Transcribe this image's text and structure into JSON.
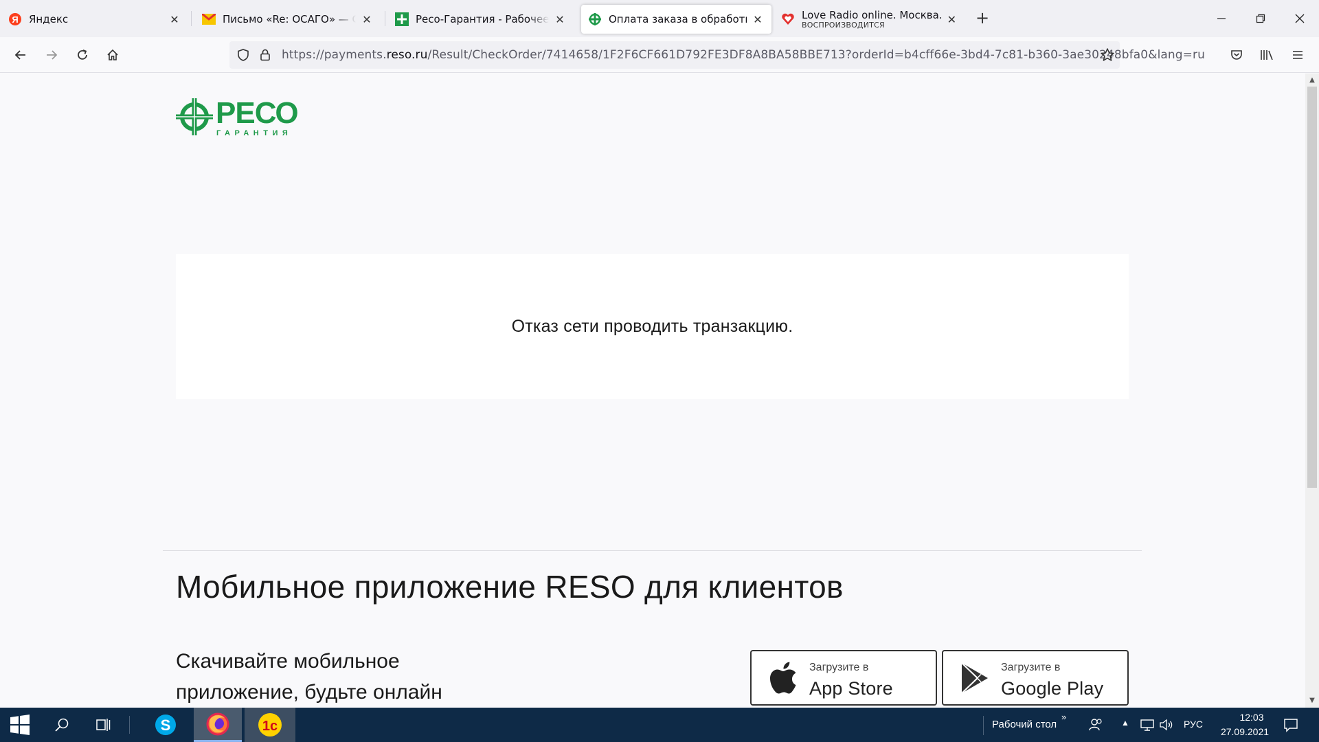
{
  "browser": {
    "tabs": [
      {
        "title": "Яндекс",
        "favicon": "yandex-icon",
        "active": false
      },
      {
        "title": "Письмо «Re: ОСАГО» — Служба",
        "favicon": "mail-icon",
        "active": false
      },
      {
        "title": "Ресо-Гарантия - Рабочее место",
        "favicon": "reso-icon",
        "active": false
      },
      {
        "title": "Оплата заказа в обработке",
        "favicon": "reso-cross-icon",
        "active": true
      },
      {
        "title": "Love Radio online. Москва.",
        "subtitle": "ВОСПРОИЗВОДИТСЯ",
        "favicon": "love-radio-icon",
        "active": false
      }
    ],
    "new_tab_label": "+",
    "url_prefix": "https://payments.",
    "url_domain": "reso.ru",
    "url_path": "/Result/CheckOrder/7414658/1F2F6CF661D792FE3DF8A8BA58BBE713?orderId=b4cff66e-3bd4-7c81-b360-3ae30248bfa0&lang=ru"
  },
  "page": {
    "logo_main": "РЕСО",
    "logo_sub": "ГАРАНТИЯ",
    "message": "Отказ сети проводить транзакцию.",
    "app_heading": "Мобильное приложение RESO для клиентов",
    "app_text": "Скачивайте мобильное приложение, будьте онлайн",
    "appstore_small": "Загрузите в",
    "appstore_big": "App Store",
    "googleplay_small": "Загрузите в",
    "googleplay_big": "Google Play"
  },
  "taskbar": {
    "desktop_label": "Рабочий стол",
    "lang": "РУС",
    "time": "12:03",
    "date": "27.09.2021"
  },
  "colors": {
    "brand_green": "#1f9a4a",
    "taskbar": "#0e2a47"
  }
}
